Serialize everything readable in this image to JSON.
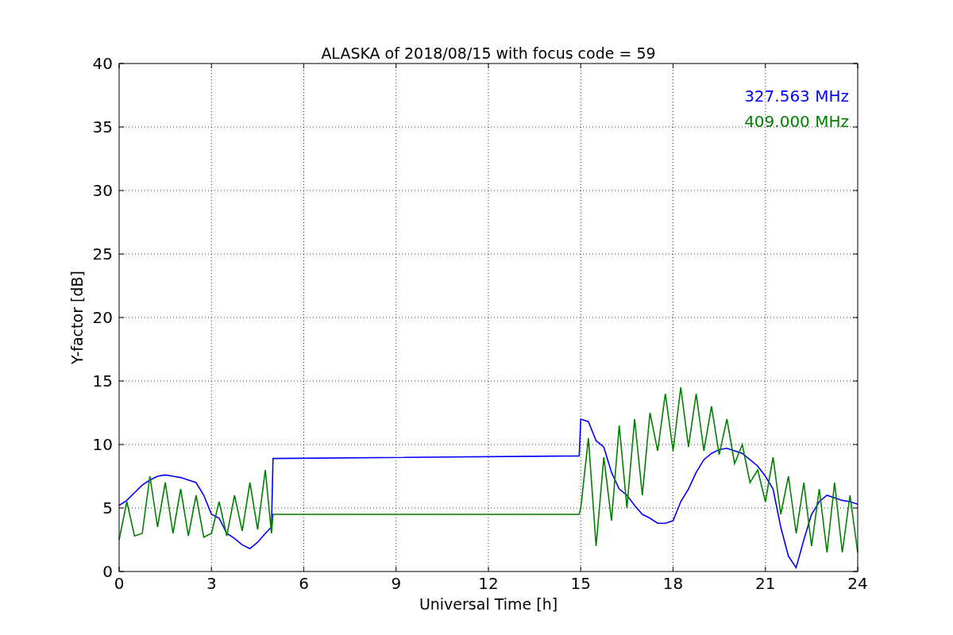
{
  "chart_data": {
    "type": "line",
    "title": "ALASKA of 2018/08/15 with focus code = 59",
    "xlabel": "Universal Time [h]",
    "ylabel": "Y-factor [dB]",
    "grid": true,
    "xlim": [
      0,
      24
    ],
    "ylim": [
      0,
      40
    ],
    "xticks": [
      0,
      3,
      6,
      9,
      12,
      15,
      18,
      21,
      24
    ],
    "yticks": [
      0,
      5,
      10,
      15,
      20,
      25,
      30,
      35,
      40
    ],
    "x": [
      0,
      0.25,
      0.5,
      0.75,
      1,
      1.25,
      1.5,
      1.75,
      2,
      2.25,
      2.5,
      2.75,
      3,
      3.25,
      3.5,
      3.75,
      4,
      4.25,
      4.5,
      4.75,
      4.95,
      5,
      14.95,
      15,
      15.25,
      15.5,
      15.75,
      16,
      16.25,
      16.5,
      16.75,
      17,
      17.25,
      17.5,
      17.75,
      18,
      18.25,
      18.5,
      18.75,
      19,
      19.25,
      19.5,
      19.75,
      20,
      20.25,
      20.5,
      20.75,
      21,
      21.25,
      21.5,
      21.75,
      22,
      22.25,
      22.5,
      22.75,
      23,
      23.25,
      23.5,
      23.75,
      24
    ],
    "series": [
      {
        "name": "327.563 MHz",
        "color": "#0000ff",
        "values": [
          5.2,
          5.6,
          6.2,
          6.8,
          7.2,
          7.5,
          7.6,
          7.5,
          7.4,
          7.2,
          7,
          6,
          4.5,
          4.2,
          3,
          2.6,
          2.1,
          1.8,
          2.3,
          3,
          3.5,
          8.9,
          9.1,
          12,
          11.8,
          10.3,
          9.8,
          7.8,
          6.5,
          6,
          5.2,
          4.5,
          4.2,
          3.8,
          3.8,
          4,
          5.5,
          6.5,
          7.8,
          8.8,
          9.3,
          9.6,
          9.7,
          9.5,
          9.3,
          8.8,
          8.3,
          7.5,
          6.5,
          3.5,
          1.2,
          0.3,
          2.5,
          4.5,
          5.5,
          6,
          5.8,
          5.6,
          5.5,
          5.3
        ]
      },
      {
        "name": "409.000 MHz",
        "color": "#008000",
        "values": [
          2.5,
          5.5,
          2.8,
          3,
          7.5,
          3.5,
          7,
          3,
          6.5,
          2.8,
          6,
          2.7,
          3,
          5.5,
          2.8,
          6,
          3.2,
          7,
          3.3,
          8,
          3,
          4.5,
          4.5,
          5,
          10.5,
          2,
          9,
          4,
          11.5,
          5,
          12,
          6,
          12.5,
          9.5,
          14,
          9.5,
          14.5,
          9.8,
          14,
          9.5,
          13,
          9.2,
          12,
          8.5,
          10,
          7,
          8,
          5.5,
          9,
          4.5,
          7.5,
          3,
          7,
          2,
          6.5,
          1.5,
          7,
          1.5,
          6,
          1.5
        ]
      }
    ]
  }
}
